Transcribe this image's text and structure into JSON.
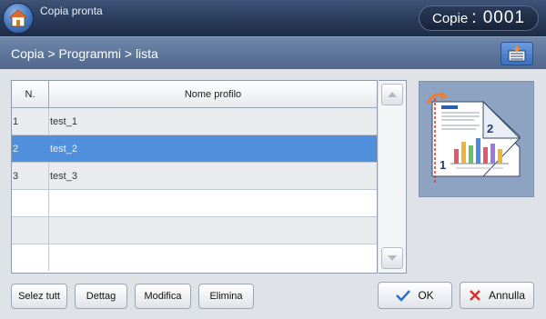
{
  "header": {
    "status": "Copia pronta",
    "counter_label": "Copie",
    "counter_value": ": 0001"
  },
  "breadcrumb": "Copia > Programmi > lista",
  "table": {
    "col_n": "N.",
    "col_name": "Nome profilo",
    "rows": [
      {
        "n": "1",
        "name": "test_1",
        "selected": false
      },
      {
        "n": "2",
        "name": "test_2",
        "selected": true
      },
      {
        "n": "3",
        "name": "test_3",
        "selected": false
      },
      {
        "n": "",
        "name": "",
        "selected": false
      },
      {
        "n": "",
        "name": "",
        "selected": false
      },
      {
        "n": "",
        "name": "",
        "selected": false
      }
    ]
  },
  "preview": {
    "page_1": "1",
    "page_2": "2"
  },
  "buttons": {
    "select_all": "Selez tutt",
    "details": "Dettag",
    "modify": "Modifica",
    "delete": "Elimina",
    "ok": "OK",
    "cancel": "Annulla"
  },
  "colors": {
    "selected_row": "#4f8fdc",
    "ok_check": "#2f6fc8",
    "cancel_x": "#d9302b"
  }
}
